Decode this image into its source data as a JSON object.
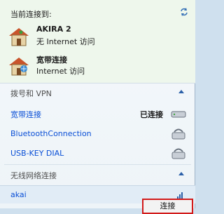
{
  "current": {
    "title": "当前连接到:",
    "networks": [
      {
        "name": "AKIRA  2",
        "access": "无 Internet 访问"
      },
      {
        "name": "宽带连接",
        "access": "Internet 访问"
      }
    ]
  },
  "dialup": {
    "title": "拨号和 VPN",
    "items": [
      {
        "label": "宽带连接",
        "status": "已连接"
      },
      {
        "label": "BluetoothConnection",
        "status": ""
      },
      {
        "label": "USB-KEY DIAL",
        "status": ""
      }
    ]
  },
  "wireless": {
    "title": "无线网络连接",
    "items": [
      {
        "label": "akai"
      }
    ]
  },
  "connect_button": "连接"
}
